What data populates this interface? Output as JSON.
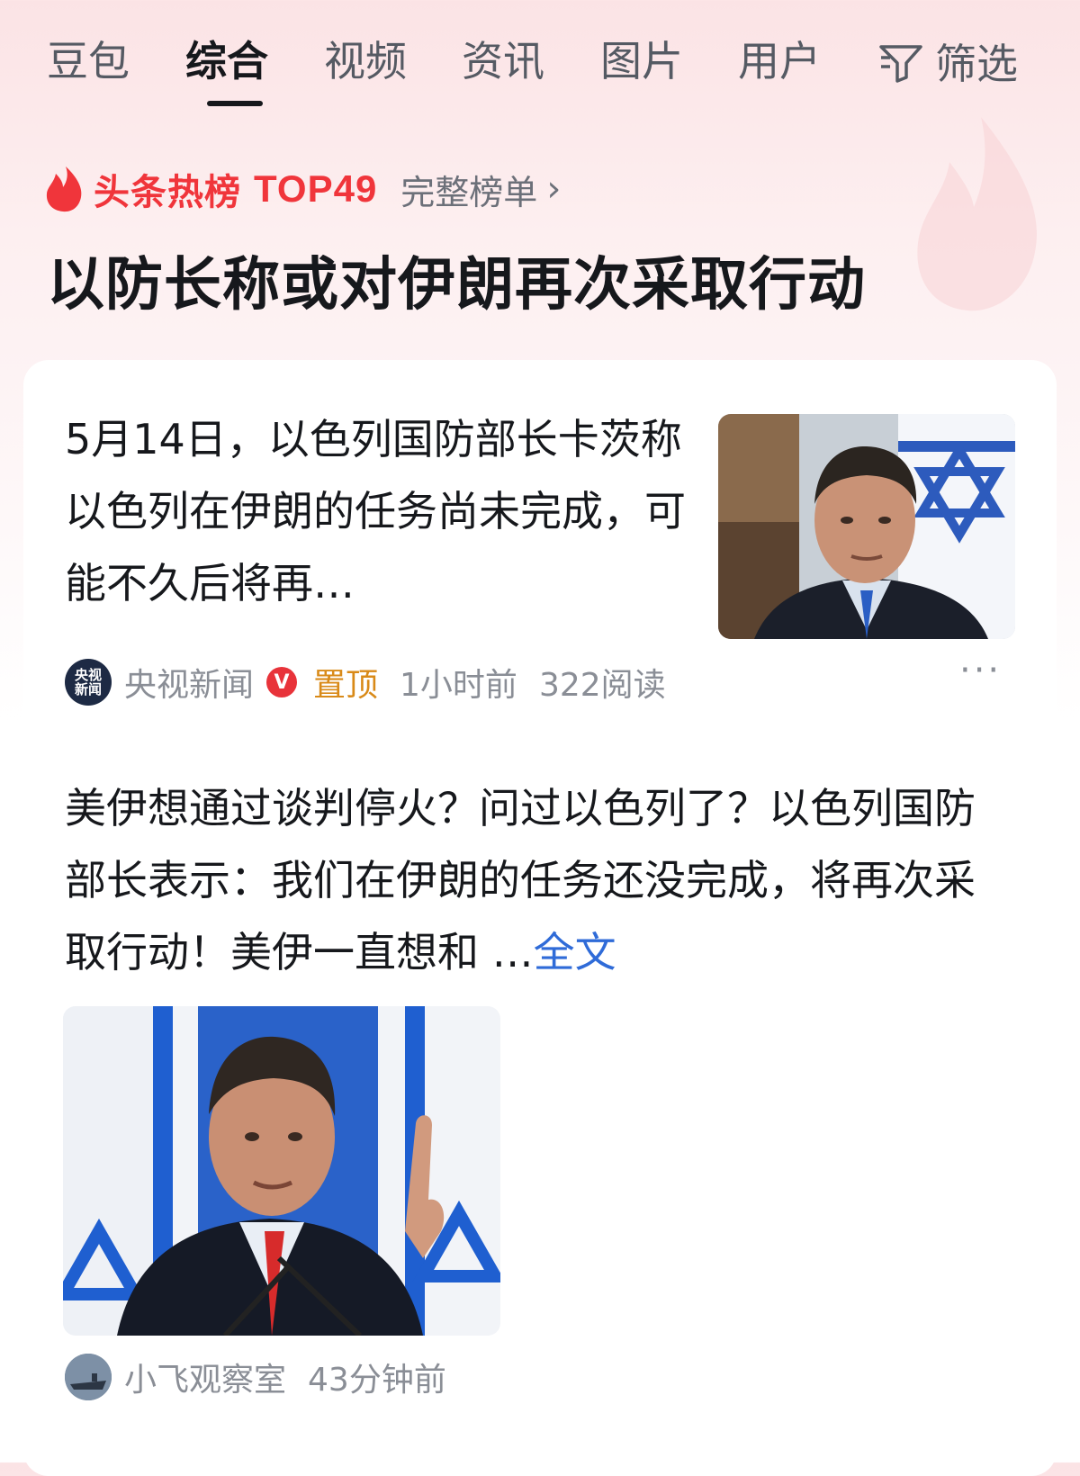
{
  "tabs": [
    {
      "label": "豆包"
    },
    {
      "label": "综合"
    },
    {
      "label": "视频"
    },
    {
      "label": "资讯"
    },
    {
      "label": "图片"
    },
    {
      "label": "用户"
    }
  ],
  "active_tab": "综合",
  "filter": {
    "label": "筛选",
    "icon": "filter-icon"
  },
  "hot": {
    "label": "头条热榜",
    "rank": "TOP49",
    "full_list": "完整榜单",
    "chevron": "›",
    "headline": "以防长称或对伊朗再次采取行动",
    "accent": "#f0353b"
  },
  "article1": {
    "text": "5月14日，以色列国防部长卡茨称以色列在伊朗的任务尚未完成，可能不久后将再…",
    "source": "央视新闻",
    "source_avatar_text": "央视新闻",
    "verified_mark": "V",
    "pinned": "置顶",
    "time": "1小时前",
    "reads": "322阅读",
    "more": "···"
  },
  "article2": {
    "text": "美伊想通过谈判停火？问过以色列了？以色列国防部长表示：我们在伊朗的任务还没完成，将再次采取行动！美伊一直想和 …",
    "full_text_link": "全文",
    "source": "小飞观察室",
    "time": "43分钟前",
    "link_color": "#2f6bd8"
  }
}
